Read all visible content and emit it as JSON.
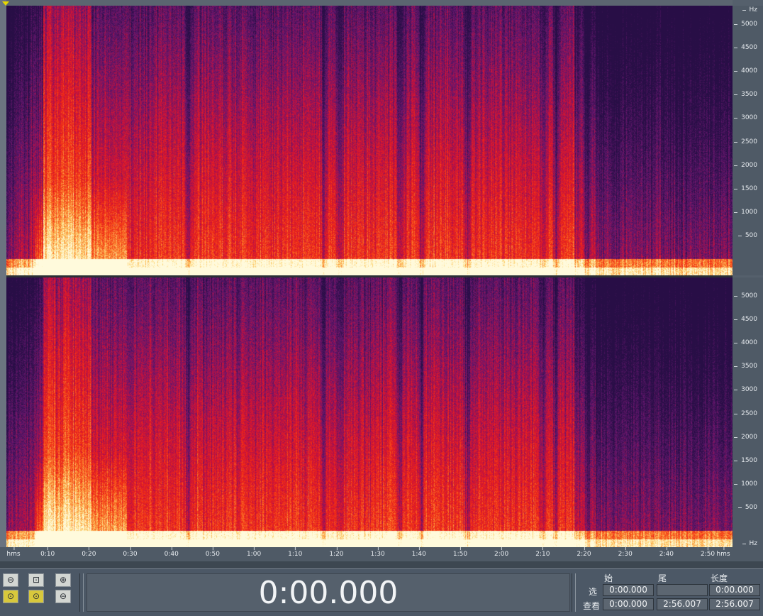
{
  "spectrogram": {
    "channels": [
      "top",
      "bottom"
    ],
    "colors": {
      "low": "#3a1a5e",
      "mid": "#e5121a",
      "high": "#fff2b0",
      "peak": "#fffbe6"
    }
  },
  "frequency_axis": {
    "unit": "Hz",
    "ticks": [
      "5000",
      "4500",
      "4000",
      "3500",
      "3000",
      "2500",
      "2000",
      "1500",
      "1000",
      "500"
    ],
    "bottom_unit": "Hz"
  },
  "time_axis": {
    "start_label": "hms",
    "end_label": "hms",
    "ticks": [
      "0:10",
      "0:20",
      "0:30",
      "0:40",
      "0:50",
      "1:00",
      "1:10",
      "1:20",
      "1:30",
      "1:40",
      "1:50",
      "2:00",
      "2:10",
      "2:20",
      "2:30",
      "2:40",
      "2:50"
    ]
  },
  "transport": {
    "current_time": "0:00.000"
  },
  "zoom_buttons": [
    {
      "name": "zoom-out-button",
      "glyph": "⊖"
    },
    {
      "name": "zoom-selection-button",
      "glyph": "⊡"
    },
    {
      "name": "zoom-in-vertical-button",
      "glyph": "⊕"
    },
    {
      "name": "zoom-left-button",
      "glyph": "⊙"
    },
    {
      "name": "zoom-right-button",
      "glyph": "⊙"
    },
    {
      "name": "zoom-out-vertical-button",
      "glyph": "⊖"
    }
  ],
  "selection_panel": {
    "headers": {
      "begin": "始",
      "end": "尾",
      "length": "长度"
    },
    "selection": {
      "label": "选",
      "begin": "0:00.000",
      "end": "",
      "length": "0:00.000"
    },
    "view": {
      "label": "查看",
      "begin": "0:00.000",
      "end": "2:56.007",
      "length": "2:56.007"
    }
  }
}
